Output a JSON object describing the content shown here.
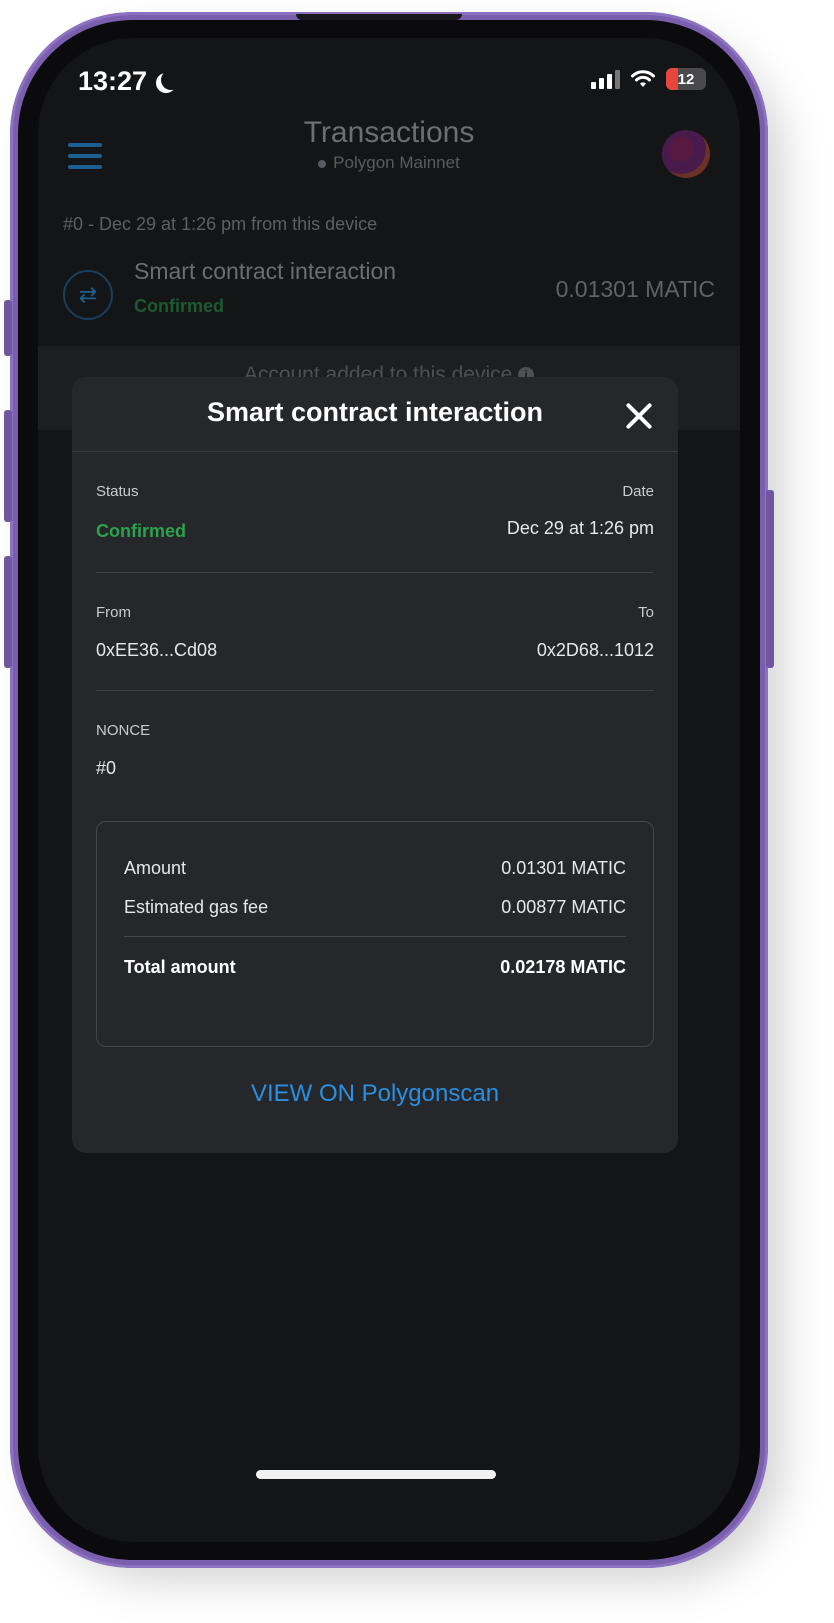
{
  "status_bar": {
    "time": "13:27",
    "battery": "12"
  },
  "header": {
    "title": "Transactions",
    "network": "Polygon Mainnet"
  },
  "transaction_list": {
    "meta": "#0 - Dec 29 at 1:26 pm from this device",
    "item": {
      "title": "Smart contract interaction",
      "status": "Confirmed",
      "amount": "0.01301 MATIC"
    },
    "account_added": "Account added to this device"
  },
  "modal": {
    "title": "Smart contract interaction",
    "status_label": "Status",
    "status_value": "Confirmed",
    "date_label": "Date",
    "date_value": "Dec 29 at 1:26 pm",
    "from_label": "From",
    "from_value": "0xEE36...Cd08",
    "to_label": "To",
    "to_value": "0x2D68...1012",
    "nonce_label": "NONCE",
    "nonce_value": "#0",
    "summary": {
      "amount_label": "Amount",
      "amount_value": "0.01301 MATIC",
      "gas_label": "Estimated gas fee",
      "gas_value": "0.00877 MATIC",
      "total_label": "Total amount",
      "total_value": "0.02178 MATIC"
    },
    "view_link": "VIEW ON Polygonscan"
  },
  "colors": {
    "phone_frame": "#7a5fae",
    "screen_bg": "#141517",
    "modal_bg": "#25272b",
    "confirmed_green": "#2ba24b",
    "link_blue": "#2a8fe0"
  }
}
